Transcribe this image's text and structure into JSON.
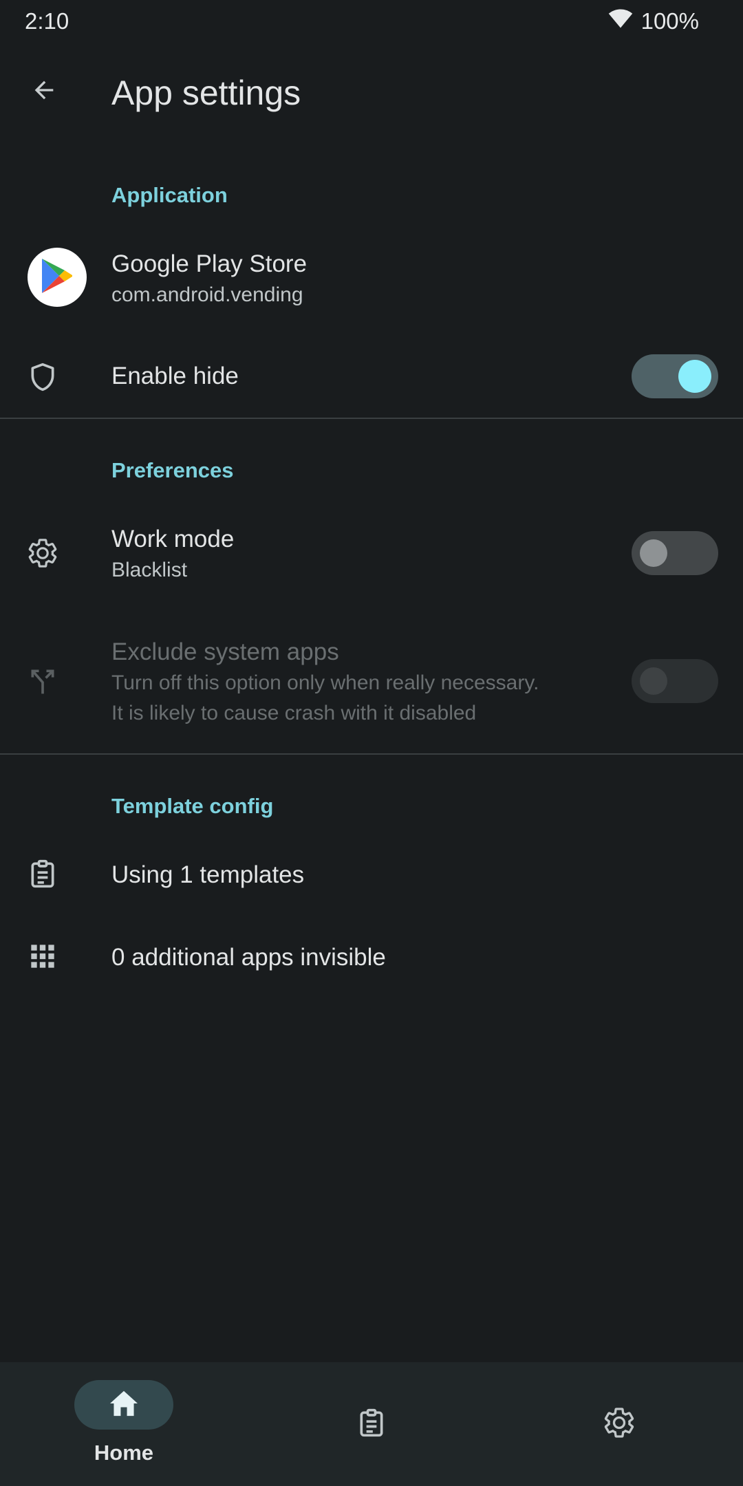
{
  "status_bar": {
    "time": "2:10",
    "battery": "100%"
  },
  "app_bar": {
    "title": "App settings"
  },
  "sections": {
    "application": "Application",
    "preferences": "Preferences",
    "template_config": "Template config"
  },
  "app": {
    "name": "Google Play Store",
    "package": "com.android.vending"
  },
  "enable_hide": {
    "label": "Enable hide",
    "enabled": true
  },
  "work_mode": {
    "label": "Work mode",
    "value": "Blacklist",
    "enabled": false
  },
  "exclude_system_apps": {
    "label": "Exclude system apps",
    "desc_line1": "Turn off this option only when really necessary.",
    "desc_line2": "It is likely to cause crash with it disabled",
    "enabled": false,
    "disabled": true
  },
  "templates": {
    "label": "Using 1 templates"
  },
  "invisible_apps": {
    "label": "0 additional apps invisible"
  },
  "bottom_nav": {
    "home_label": "Home"
  },
  "colors": {
    "accent": "#7dd1dd",
    "background": "#191c1e",
    "switch_thumb_on": "#8aeefc"
  },
  "icons": [
    "back-arrow-icon",
    "wifi-icon",
    "shield-icon",
    "gear-icon",
    "fork-icon",
    "clipboard-icon",
    "grid-icon",
    "home-icon",
    "google-play-icon"
  ]
}
